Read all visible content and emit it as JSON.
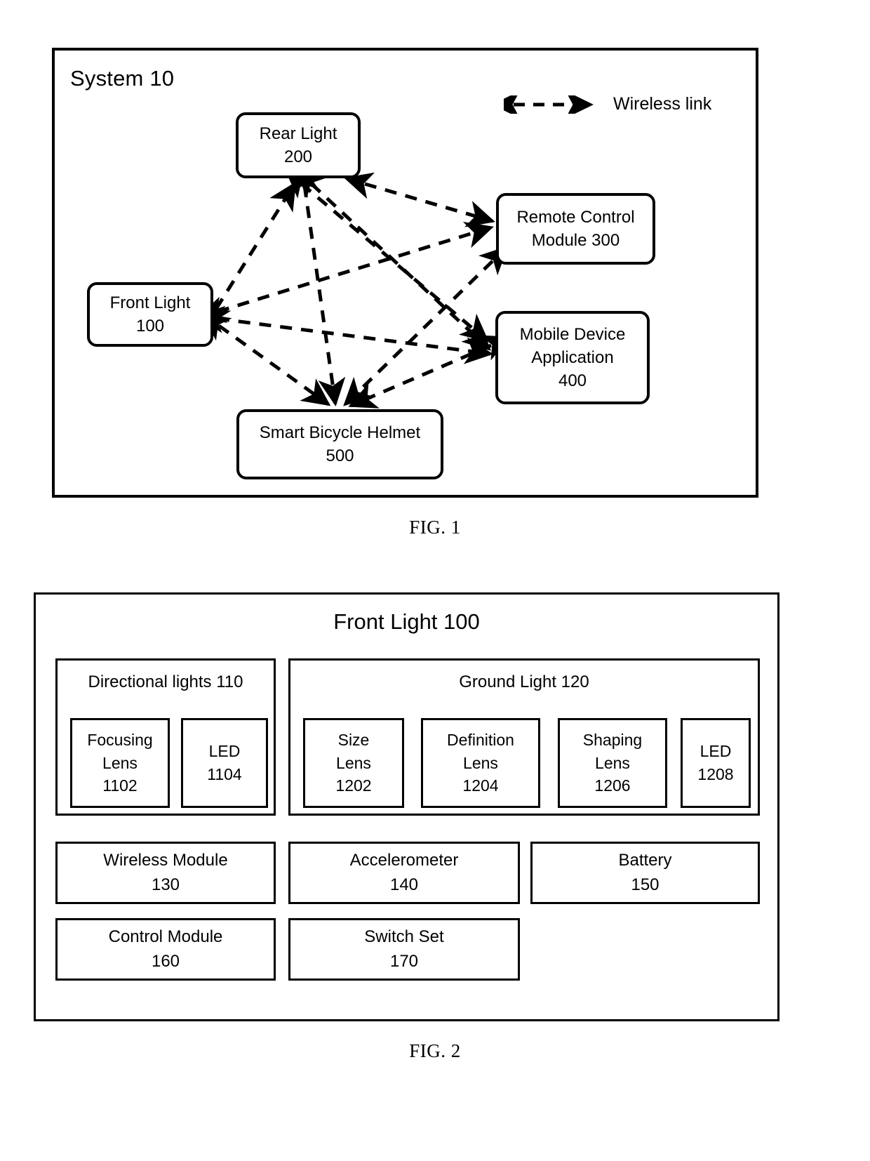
{
  "figure1": {
    "caption": "FIG. 1",
    "title": "System 10",
    "legend": {
      "icon": "double-headed-dashed-arrow-icon",
      "label": "Wireless link"
    },
    "nodes": [
      {
        "id": "rear-light",
        "line1": "Rear Light",
        "line2": "200"
      },
      {
        "id": "remote",
        "line1": "Remote Control",
        "line2": "Module 300"
      },
      {
        "id": "front-light",
        "line1": "Front Light",
        "line2": "100"
      },
      {
        "id": "mobile",
        "line1": "Mobile Device",
        "line2": "Application",
        "line3": "400"
      },
      {
        "id": "helmet",
        "line1": "Smart Bicycle Helmet",
        "line2": "500"
      }
    ],
    "links": [
      {
        "from": "front-light",
        "to": "rear-light"
      },
      {
        "from": "front-light",
        "to": "remote"
      },
      {
        "from": "front-light",
        "to": "mobile"
      },
      {
        "from": "front-light",
        "to": "helmet"
      },
      {
        "from": "rear-light",
        "to": "remote"
      },
      {
        "from": "rear-light",
        "to": "mobile"
      },
      {
        "from": "rear-light",
        "to": "helmet"
      },
      {
        "from": "remote",
        "to": "helmet"
      },
      {
        "from": "mobile",
        "to": "helmet"
      },
      {
        "from": "remote",
        "to": "mobile"
      }
    ]
  },
  "figure2": {
    "caption": "FIG. 2",
    "title": "Front Light 100",
    "groups": [
      {
        "id": "directional-lights",
        "title": "Directional lights 110",
        "children": [
          {
            "id": "focusing-lens",
            "line1": "Focusing",
            "line2": "Lens",
            "line3": "1102"
          },
          {
            "id": "led-1104",
            "line1": "LED",
            "line2": "1104",
            "line3": ""
          }
        ]
      },
      {
        "id": "ground-light",
        "title": "Ground Light 120",
        "children": [
          {
            "id": "size-lens",
            "line1": "Size",
            "line2": "Lens",
            "line3": "1202"
          },
          {
            "id": "definition-lens",
            "line1": "Definition",
            "line2": "Lens",
            "line3": "1204"
          },
          {
            "id": "shaping-lens",
            "line1": "Shaping",
            "line2": "Lens",
            "line3": "1206"
          },
          {
            "id": "led-1208",
            "line1": "LED",
            "line2": "1208",
            "line3": ""
          }
        ]
      }
    ],
    "modules": [
      {
        "id": "wireless-module",
        "line1": "Wireless Module",
        "line2": "130"
      },
      {
        "id": "accelerometer",
        "line1": "Accelerometer",
        "line2": "140"
      },
      {
        "id": "battery",
        "line1": "Battery",
        "line2": "150"
      },
      {
        "id": "control-module",
        "line1": "Control Module",
        "line2": "160"
      },
      {
        "id": "switch-set",
        "line1": "Switch Set",
        "line2": "170"
      }
    ]
  },
  "colors": {
    "line": "#000000",
    "background": "#ffffff"
  }
}
